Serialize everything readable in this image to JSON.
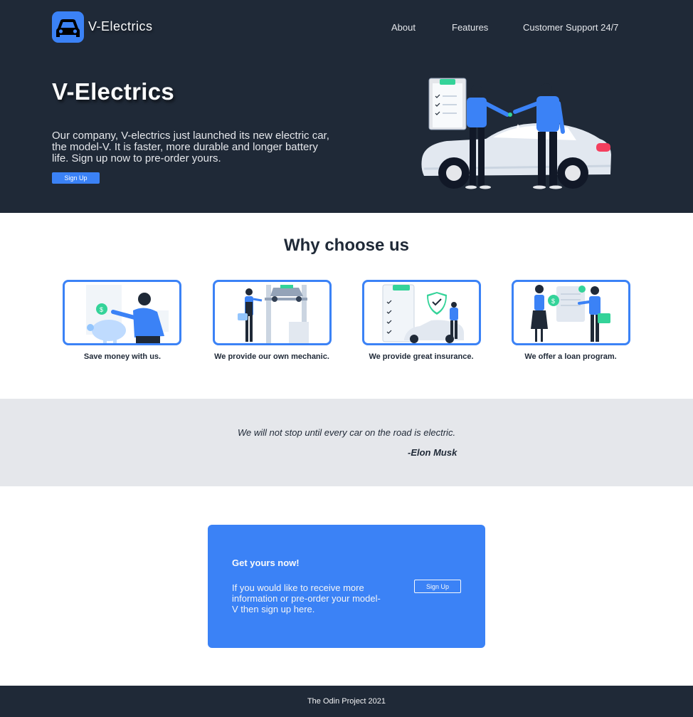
{
  "brand": {
    "name": "V-Electrics",
    "accent": "#3b82f6",
    "dark": "#1f2937",
    "logo_icon": "car-icon"
  },
  "nav": {
    "items": [
      "About",
      "Features",
      "Customer Support 24/7"
    ]
  },
  "hero": {
    "title": "V-Electrics",
    "description": "Our company, V-electrics just launched its new electric car, the model-V. It is faster, more durable and longer battery life. Sign up now to pre-order yours.",
    "button_label": "Sign Up",
    "image_icon": "car-handover-illustration"
  },
  "features": {
    "title": "Why choose us",
    "cards": [
      {
        "caption": "Save money with us.",
        "icon": "piggy-bank-illustration"
      },
      {
        "caption": "We provide our own mechanic.",
        "icon": "mechanic-illustration"
      },
      {
        "caption": "We provide great insurance.",
        "icon": "insurance-illustration"
      },
      {
        "caption": "We offer a loan program.",
        "icon": "loan-illustration"
      }
    ]
  },
  "quote": {
    "text": "We will not stop until every car on the road is electric.",
    "author": "-Elon Musk"
  },
  "cta": {
    "title": "Get yours now!",
    "text": "If you would like to receive more information or pre-order your model-V then sign up here.",
    "button_label": "Sign Up"
  },
  "footer": {
    "text": "The Odin Project 2021"
  }
}
